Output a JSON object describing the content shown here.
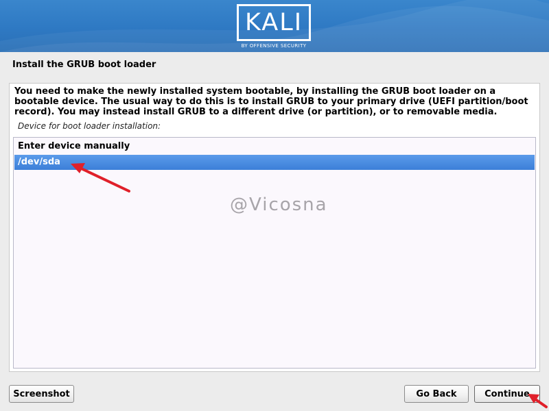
{
  "header": {
    "logo_text": "KALI",
    "logo_subtitle": "BY OFFENSIVE SECURITY"
  },
  "step": {
    "title": "Install the GRUB boot loader"
  },
  "main": {
    "description": "You need to make the newly installed system bootable, by installing the GRUB boot loader on a bootable device. The usual way to do this is to install GRUB to your primary drive (UEFI partition/boot record). You may instead install GRUB to a different drive (or partition), or to removable media.",
    "field_label": "Device for boot loader installation:",
    "options": [
      {
        "label": "Enter device manually",
        "selected": false
      },
      {
        "label": "/dev/sda",
        "selected": true
      }
    ],
    "watermark": "@Vicosna"
  },
  "buttons": {
    "screenshot": "Screenshot",
    "go_back": "Go Back",
    "continue": "Continue"
  },
  "colors": {
    "header": "#2f7ac4",
    "selection": "#4a8ce0",
    "annotation_arrow": "#e0202a"
  }
}
